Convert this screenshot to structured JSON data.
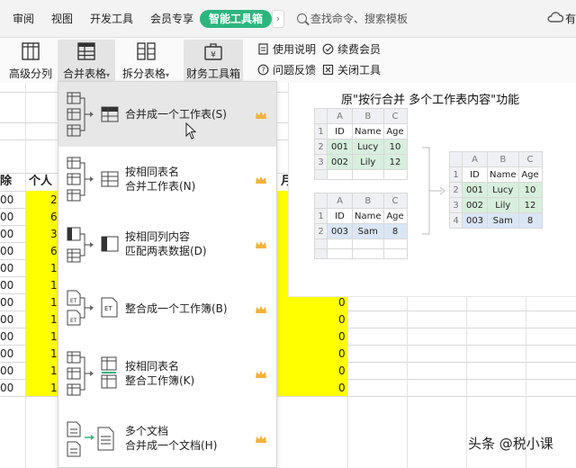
{
  "tabs": {
    "items": [
      "审阅",
      "视图",
      "开发工具",
      "会员专享",
      "智能工具箱"
    ],
    "more": "›",
    "search_placeholder": "查找命令、搜索模板",
    "cloud_label": "有"
  },
  "ribbon": {
    "buttons": [
      "高级分列",
      "合并表格",
      "拆分表格",
      "财务工具箱"
    ],
    "dropdown_caret": "▾",
    "small": [
      "使用说明",
      "续费会员",
      "问题反馈",
      "关闭工具"
    ]
  },
  "sheet": {
    "left_header": [
      "除",
      "个人"
    ],
    "header_right": "月",
    "left_col": [
      "00",
      "00",
      "00",
      "00",
      "00",
      "00",
      "00",
      "00",
      "00",
      "00",
      "00",
      "00"
    ],
    "yellow_left": [
      "2",
      "6",
      "3",
      "6",
      "1",
      "1",
      "1",
      "1",
      "1",
      "1",
      "1",
      "1"
    ],
    "zero_values": [
      "0",
      "0",
      "0",
      "0",
      "0",
      "0"
    ]
  },
  "menu": {
    "items": [
      {
        "line1": "合并成一个工作表(S)",
        "line2": ""
      },
      {
        "line1": "按相同表名",
        "line2": "合并工作表(N)"
      },
      {
        "line1": "按相同列内容",
        "line2": "匹配两表数据(D)"
      },
      {
        "line1": "整合成一个工作簿(B)",
        "line2": ""
      },
      {
        "line1": "按相同表名",
        "line2": "整合工作簿(K)"
      },
      {
        "line1": "多个文档",
        "line2": "合并成一个文档(H)"
      }
    ],
    "et_label": "ET"
  },
  "panel": {
    "title": "原\"按行合并 多个工作表内容\"功能",
    "col_letters": [
      "A",
      "B",
      "C"
    ],
    "headers": [
      "ID",
      "Name",
      "Age"
    ],
    "table1": [
      [
        "001",
        "Lucy",
        "10"
      ],
      [
        "002",
        "Lily",
        "12"
      ]
    ],
    "table2": [
      [
        "003",
        "Sam",
        "8"
      ]
    ],
    "result": [
      [
        "001",
        "Lucy",
        "10"
      ],
      [
        "002",
        "Lily",
        "12"
      ],
      [
        "003",
        "Sam",
        "8"
      ]
    ],
    "row_numbers": [
      "1",
      "2",
      "3",
      "4"
    ]
  },
  "watermark": "头条 @税小课",
  "colors": {
    "accent": "#2db57e",
    "crown": "#f2b33d",
    "highlight_yellow": "#ffff00",
    "mini_green": "#d7efdc",
    "mini_blue": "#dbe6f5"
  }
}
